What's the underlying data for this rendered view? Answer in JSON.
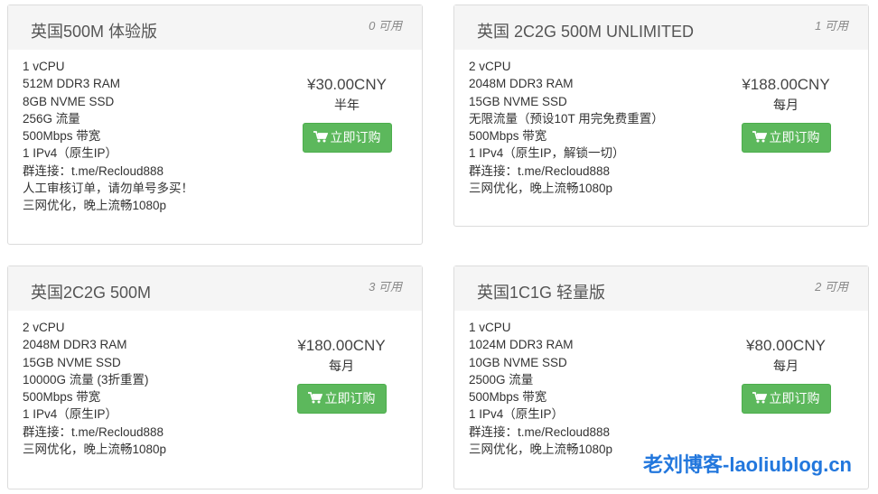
{
  "currency_button_label": "立即订购",
  "cards": [
    {
      "title": "英国500M 体验版",
      "availability": "0 可用",
      "features": [
        "1 vCPU",
        "512M DDR3 RAM",
        "8GB NVME SSD",
        "256G 流量",
        "500Mbps 带宽",
        "1 IPv4（原生IP）",
        "群连接：t.me/Recloud888",
        "人工审核订单，请勿单号多买！",
        "三网优化，晚上流畅1080p"
      ],
      "price": "¥30.00CNY",
      "cycle": "半年",
      "button": "立即订购"
    },
    {
      "title": "英国 2C2G 500M UNLIMITED",
      "availability": "1 可用",
      "features": [
        "2 vCPU",
        "2048M DDR3 RAM",
        "15GB NVME SSD",
        "无限流量（预设10T 用完免费重置）",
        "500Mbps 带宽",
        "1 IPv4（原生IP，解锁一切）",
        "群连接：t.me/Recloud888",
        "三网优化，晚上流畅1080p"
      ],
      "price": "¥188.00CNY",
      "cycle": "每月",
      "button": "立即订购"
    },
    {
      "title": "英国2C2G 500M",
      "availability": "3 可用",
      "features": [
        "2 vCPU",
        "2048M DDR3 RAM",
        "15GB NVME SSD",
        "10000G 流量 (3折重置)",
        "500Mbps 带宽",
        "1 IPv4（原生IP）",
        "群连接：t.me/Recloud888",
        "三网优化，晚上流畅1080p"
      ],
      "price": "¥180.00CNY",
      "cycle": "每月",
      "button": "立即订购"
    },
    {
      "title": "英国1C1G 轻量版",
      "availability": "2 可用",
      "features": [
        "1 vCPU",
        "1024M DDR3 RAM",
        "10GB NVME SSD",
        "2500G 流量",
        "500Mbps 带宽",
        "1 IPv4（原生IP）",
        "群连接：t.me/Recloud888",
        "三网优化，晚上流畅1080p"
      ],
      "price": "¥80.00CNY",
      "cycle": "每月",
      "button": "立即订购"
    }
  ],
  "watermark": "老刘博客-laoliublog.cn",
  "colors": {
    "button": "#5cb85c",
    "header_bg": "#f5f5f5",
    "watermark": "#2277dd"
  },
  "icons": {
    "button_icon": "shopping-cart-icon"
  }
}
